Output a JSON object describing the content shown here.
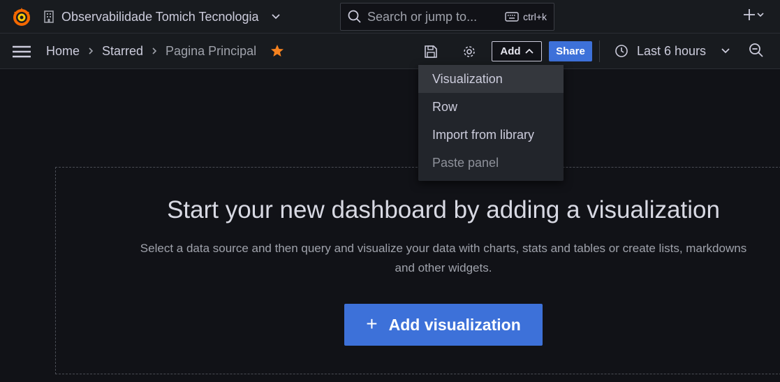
{
  "topbar": {
    "org_name": "Observabilidade Tomich Tecnologia",
    "search_placeholder": "Search or jump to...",
    "search_shortcut": "ctrl+k",
    "brand_color": "#f46800"
  },
  "toolbar": {
    "breadcrumbs": [
      "Home",
      "Starred",
      "Pagina Principal"
    ],
    "add_label": "Add",
    "share_label": "Share",
    "time_range": "Last 6 hours",
    "accent_color": "#3d71d9"
  },
  "add_menu": {
    "items": [
      {
        "label": "Visualization",
        "state": "hover"
      },
      {
        "label": "Row",
        "state": "enabled"
      },
      {
        "label": "Import from library",
        "state": "enabled"
      },
      {
        "label": "Paste panel",
        "state": "disabled"
      }
    ]
  },
  "main": {
    "headline": "Start your new dashboard by adding a visualization",
    "description": "Select a data source and then query and visualize your data with charts, stats and tables or create lists, markdowns and other widgets.",
    "cta_label": "Add visualization"
  }
}
